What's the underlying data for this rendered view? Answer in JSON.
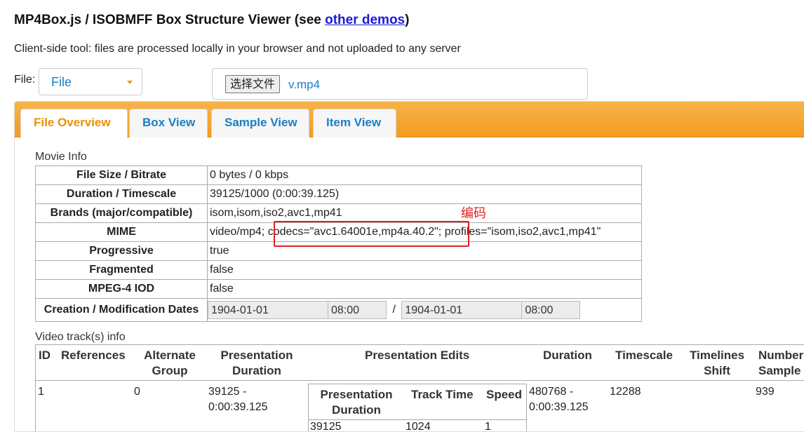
{
  "page": {
    "title_prefix": "MP4Box.js / ISOBMFF Box Structure Viewer (see ",
    "title_link": "other demos",
    "title_suffix": ")",
    "subtitle": "Client-side tool: files are processed locally in your browser and not uploaded to any server"
  },
  "file": {
    "label": "File:",
    "dropdown_value": "File",
    "choose_button": "选择文件",
    "file_name": "v.mp4"
  },
  "tabs": [
    "File Overview",
    "Box View",
    "Sample View",
    "Item View"
  ],
  "movie_info": {
    "label": "Movie Info",
    "rows": [
      {
        "key": "File Size / Bitrate",
        "value": "0 bytes / 0 kbps"
      },
      {
        "key": "Duration / Timescale",
        "value": "39125/1000 (0:00:39.125)"
      },
      {
        "key": "Brands (major/compatible)",
        "value": "isom,isom,iso2,avc1,mp41"
      },
      {
        "key": "MIME",
        "value": "video/mp4; codecs=\"avc1.64001e,mp4a.40.2\"; profiles=\"isom,iso2,avc1,mp41\""
      },
      {
        "key": "Progressive",
        "value": "true"
      },
      {
        "key": "Fragmented",
        "value": "false"
      },
      {
        "key": "MPEG-4 IOD",
        "value": "false"
      }
    ],
    "dates": {
      "key": "Creation / Modification Dates",
      "creation_date": "1904-01-01",
      "creation_time": "08:00",
      "separator": "/",
      "modification_date": "1904-01-01",
      "modification_time": "08:00"
    }
  },
  "annotation": {
    "text": "编码"
  },
  "video_tracks": {
    "label": "Video track(s) info",
    "headers": {
      "id": "ID",
      "references": "References",
      "alternate_group": "Alternate Group",
      "presentation_duration": "Presentation Duration",
      "presentation_edits": "Presentation Edits",
      "duration": "Duration",
      "timescale": "Timescale",
      "timelines_shift": "Timelines Shift",
      "number_samples": "Number Sample"
    },
    "row": {
      "id": "1",
      "alternate_group": "0",
      "presentation_duration": "39125 - 0:00:39.125",
      "duration": "480768 - 0:00:39.125",
      "timescale": "12288",
      "number_samples": "939"
    },
    "edits": {
      "headers": {
        "presentation_duration": "Presentation Duration",
        "track_time": "Track Time",
        "speed": "Speed"
      },
      "row": {
        "presentation_duration": "39125",
        "track_time": "1024",
        "speed": "1"
      }
    }
  }
}
